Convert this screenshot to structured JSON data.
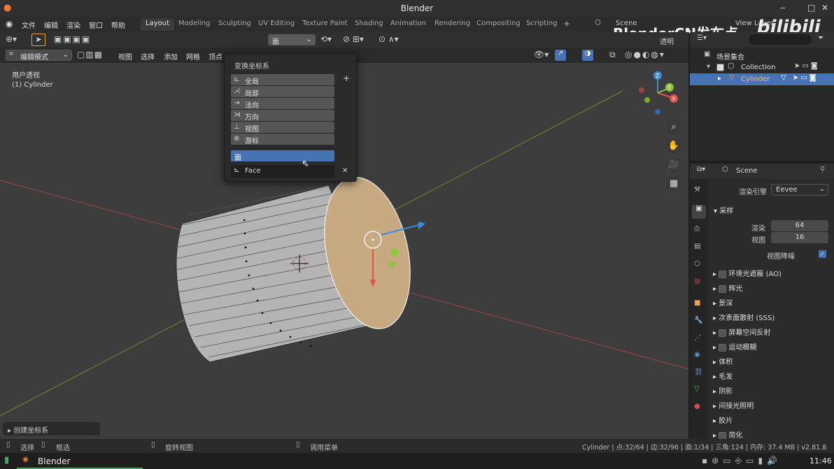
{
  "window": {
    "title": "Blender",
    "min": "‒",
    "max": "□",
    "close": "✕"
  },
  "menubar": {
    "items": [
      "文件",
      "编辑",
      "渲染",
      "窗口",
      "帮助"
    ],
    "workspaces": [
      "Layout",
      "Modeling",
      "Sculpting",
      "UV Editing",
      "Texture Paint",
      "Shading",
      "Animation",
      "Rendering",
      "Compositing",
      "Scripting"
    ],
    "add_ws": "+",
    "scene": "Scene",
    "view_layer": "View Layer",
    "watermark": "BlenderCN发布点",
    "bili_logo": "bilibili"
  },
  "toolheader": {
    "orientation_value": "面",
    "transparent": "透明"
  },
  "header2": {
    "mode": "编辑模式",
    "menus": [
      "视图",
      "选择",
      "添加",
      "网格",
      "顶点"
    ]
  },
  "viewport": {
    "view_name": "用户透视",
    "object_name": "(1) Cylinder",
    "create_orientation": "创建坐标系"
  },
  "popup": {
    "title": "变换坐标系",
    "options": [
      "全局",
      "局部",
      "法向",
      "万向",
      "视图",
      "游标"
    ],
    "selected": "面",
    "custom_name": "Face",
    "add": "+",
    "remove": "✕"
  },
  "outliner": {
    "scene_collection": "场景集合",
    "collection": "Collection",
    "object": "Cylinder",
    "search_placeholder": ""
  },
  "properties": {
    "scene": "Scene",
    "render_engine_label": "渲染引擎",
    "render_engine": "Eevee",
    "sampling": "采样",
    "render_label": "渲染",
    "render_value": "64",
    "viewport_label": "视图",
    "viewport_value": "16",
    "denoise_label": "视图降噪",
    "panels": [
      {
        "label": "环境光遮蔽 (AO)",
        "check": true
      },
      {
        "label": "辉光",
        "check": true
      },
      {
        "label": "景深",
        "check": false
      },
      {
        "label": "次表面散射 (SSS)",
        "check": false
      },
      {
        "label": "屏幕空间反射",
        "check": true
      },
      {
        "label": "运动模糊",
        "check": true
      },
      {
        "label": "体积",
        "check": false
      },
      {
        "label": "毛发",
        "check": false
      },
      {
        "label": "阴影",
        "check": false
      },
      {
        "label": "间接光照明",
        "check": false
      },
      {
        "label": "胶片",
        "check": false
      },
      {
        "label": "简化",
        "check": true
      }
    ]
  },
  "statusbar": {
    "select": "选择",
    "box_select": "框选",
    "rotate": "旋转视图",
    "call_menu": "调用菜单",
    "stats": "Cylinder | 点:32/64 | 边:32/96 | 面:1/34 | 三角:124 | 内存: 37.4 MB | v2.81.8"
  },
  "taskbar": {
    "app": "Blender",
    "clock": "11:46"
  },
  "colors": {
    "accent": "#4772b3",
    "selected_face": "#c8aa82",
    "axis_x": "#e05050",
    "axis_y": "#8cc83c",
    "axis_z": "#3c8cdc"
  }
}
